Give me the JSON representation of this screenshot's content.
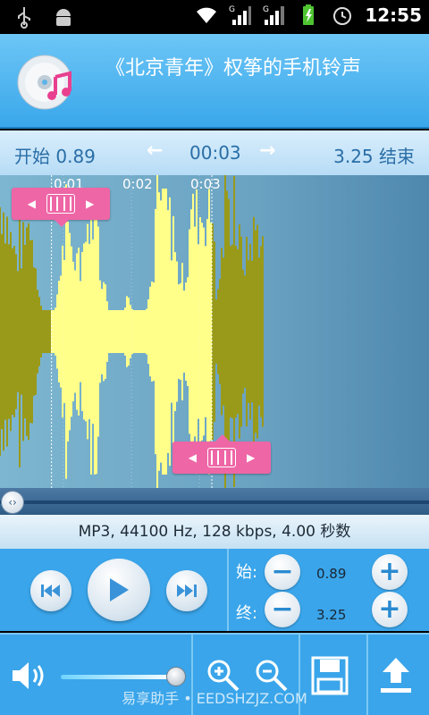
{
  "status_bar": {
    "time": "12:55",
    "icons": [
      "usb-icon",
      "android-debug-icon",
      "wifi-icon",
      "signal-g-icon",
      "signal-g2-icon",
      "battery-charging-icon",
      "alarm-icon"
    ]
  },
  "header": {
    "title": "《北京青年》权筝的手机铃声",
    "logo_icon": "music-cd-icon"
  },
  "range_bar": {
    "start_label": "开始 0.89",
    "position": "00:03",
    "end_label": "3.25 结束",
    "prev_icon": "arrow-left-icon",
    "next_icon": "arrow-right-icon"
  },
  "waveform": {
    "time_ticks": [
      "0:01",
      "0:02",
      "0:03"
    ],
    "selection_start": 0.89,
    "selection_end": 3.25,
    "playhead": 3.0,
    "duration": 4.0,
    "colors": {
      "background": "#7db6d0",
      "unselected": "#9a9a1a",
      "selected": "#ffff8a",
      "marker": "#ee66a6"
    }
  },
  "scrollbar": {
    "knob_icon": "scroll-knob-icon"
  },
  "info": {
    "text": "MP3, 44100 Hz, 128 kbps, 4.00 秒数"
  },
  "controls": {
    "prev_icon": "skip-back-icon",
    "play_icon": "play-icon",
    "next_icon": "skip-forward-icon",
    "start_label": "始:",
    "start_value": "0.89",
    "end_label": "终:",
    "end_value": "3.25"
  },
  "toolbar": {
    "volume_icon": "volume-icon",
    "volume_level": 0.95,
    "zoom_in_icon": "zoom-in-icon",
    "zoom_out_icon": "zoom-out-icon",
    "save_icon": "save-icon",
    "upload_icon": "upload-icon"
  },
  "watermark": "易享助手 • EEDSHZJZ.COM"
}
